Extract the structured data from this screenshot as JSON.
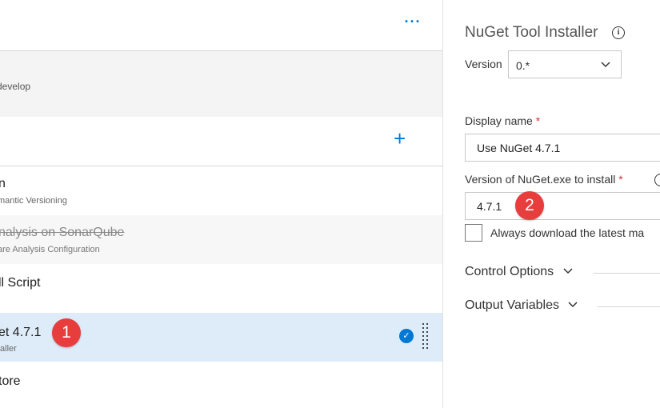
{
  "toolbar": {
    "more_label": "···"
  },
  "branch": {
    "sub": "develop"
  },
  "phase": {
    "add_label": "+"
  },
  "tasks": [
    {
      "title": "n",
      "subtitle": "mantic Versioning"
    },
    {
      "title": "nalysis on SonarQube",
      "subtitle": "are Analysis Configuration"
    },
    {
      "title": "ll Script",
      "subtitle": ""
    },
    {
      "title": "et 4.7.1",
      "subtitle": "taller"
    },
    {
      "title": "tore",
      "subtitle": ""
    }
  ],
  "callouts": {
    "one": "1",
    "two": "2"
  },
  "panel": {
    "title": "NuGet Tool Installer",
    "info_icon": "i",
    "version_label": "Version",
    "version_value": "0.*",
    "display_name_label": "Display name",
    "display_name_value": "Use NuGet 4.7.1",
    "nuget_version_label": "Version of NuGet.exe to install",
    "nuget_version_value": "4.7.1",
    "required_mark": "*",
    "checkbox_label": "Always download the latest ma",
    "control_options": "Control Options",
    "output_variables": "Output Variables"
  },
  "colors": {
    "accent": "#0078d4",
    "badge": "#e83d3d",
    "selected_row": "#deecf9",
    "required": "#d13438"
  }
}
